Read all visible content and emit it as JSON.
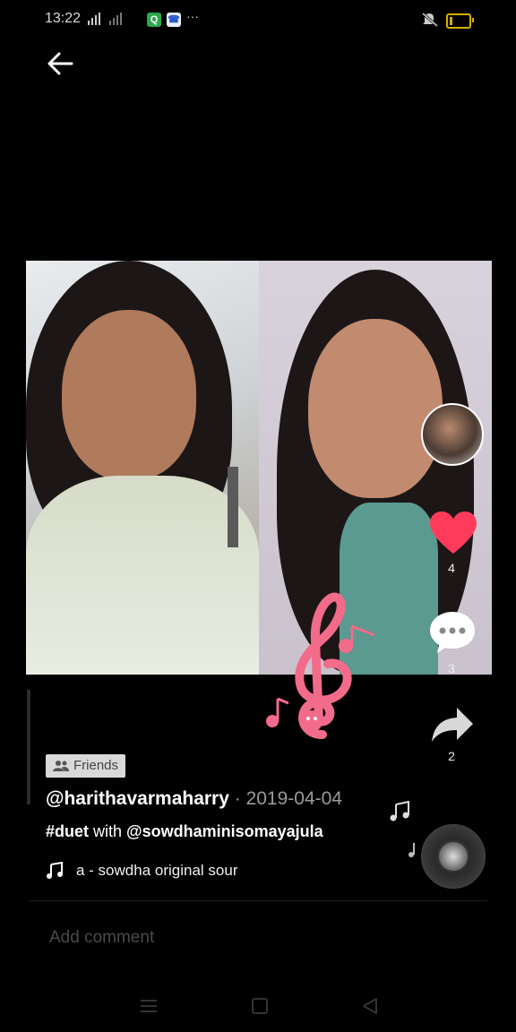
{
  "status_bar": {
    "time": "13:22",
    "signal": "°ⁿíııı ˣııı",
    "more": "···",
    "app_badge_1": "Q",
    "app_badge_2": "☎"
  },
  "video": {
    "avatar_icon": "user-avatar-icon",
    "like_count": "4",
    "comment_count": "3",
    "share_count": "2"
  },
  "post": {
    "friends_badge": "Friends",
    "username": "@harithavarmaharry",
    "date": " · 2019-04-04",
    "hashtag": "#duet",
    "with_text": " with ",
    "mention": "@sowdhaminisomayajula",
    "music_text": "a - sowdha    original sour"
  },
  "comment": {
    "placeholder": "Add comment"
  },
  "colors": {
    "like": "#ff3b5c",
    "background": "#000000",
    "music_note": "#f26b8a"
  }
}
